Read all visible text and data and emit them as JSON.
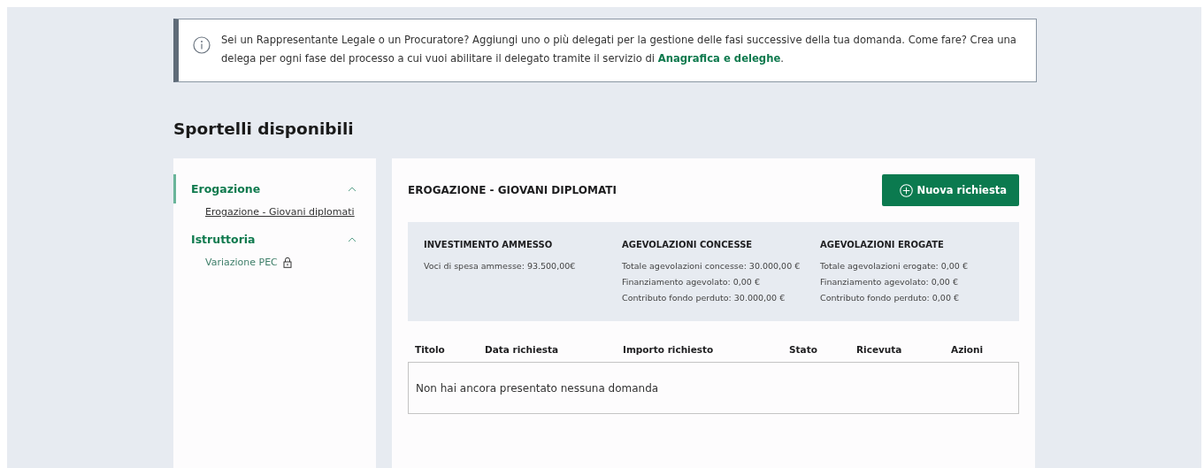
{
  "notice": {
    "text": "Sei un Rappresentante Legale o un Procuratore? Aggiungi uno o più delegati per la gestione delle fasi successive della tua domanda. Come fare? Crea una delega per ogni fase del processo a cui vuoi abilitare il delegato tramite il servizio di ",
    "link": "Anagrafica e deleghe",
    "after": "."
  },
  "heading": "Sportelli disponibili",
  "sidebar": {
    "groups": [
      {
        "label": "Erogazione",
        "expanded": true,
        "selected": true,
        "children": [
          {
            "label": "Erogazione - Giovani diplomati",
            "selected": true,
            "locked": false
          }
        ]
      },
      {
        "label": "Istruttoria",
        "expanded": true,
        "selected": false,
        "children": [
          {
            "label": "Variazione PEC",
            "selected": false,
            "locked": true
          }
        ]
      }
    ]
  },
  "panel": {
    "title": "EROGAZIONE - GIOVANI DIPLOMATI",
    "button": "Nuova richiesta",
    "summary": [
      {
        "title": "INVESTIMENTO AMMESSO",
        "lines": [
          "Voci di spesa ammesse: 93.500,00€"
        ]
      },
      {
        "title": "AGEVOLAZIONI CONCESSE",
        "lines": [
          "Totale agevolazioni concesse: 30.000,00 €",
          "Finanziamento agevolato: 0,00 €",
          "Contributo fondo perduto: 30.000,00 €"
        ]
      },
      {
        "title": "AGEVOLAZIONI EROGATE",
        "lines": [
          "Totale agevolazioni erogate: 0,00 €",
          "Finanziamento agevolato: 0,00 €",
          "Contributo fondo perduto: 0,00 €"
        ]
      }
    ],
    "table": {
      "columns": [
        "Titolo",
        "Data richiesta",
        "Importo richiesto",
        "Stato",
        "Ricevuta",
        "Azioni"
      ],
      "empty_message": "Non hai ancora presentato nessuna domanda"
    }
  }
}
